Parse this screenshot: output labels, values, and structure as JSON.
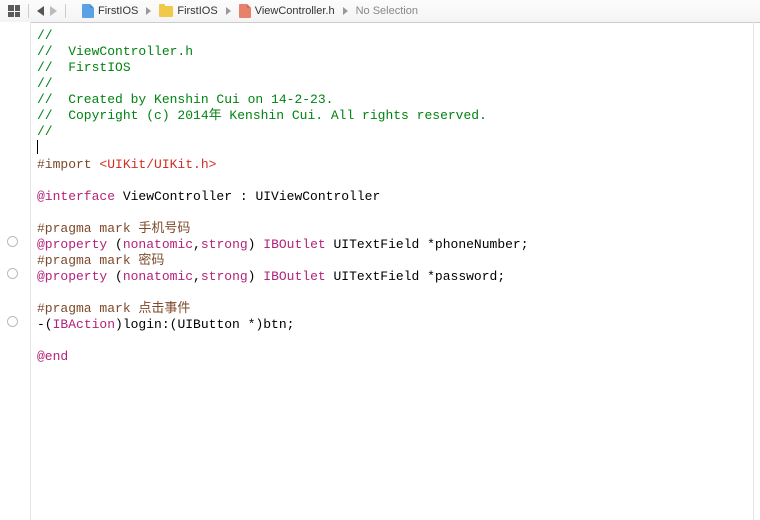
{
  "breadcrumb": {
    "items": [
      {
        "label": "FirstIOS"
      },
      {
        "label": "FirstIOS"
      },
      {
        "label": "ViewController.h"
      },
      {
        "label": "No Selection"
      }
    ]
  },
  "code": {
    "l0": "//",
    "l1": "//  ViewController.h",
    "l2": "//  FirstIOS",
    "l3": "//",
    "l4": "//  Created by Kenshin Cui on 14-2-23.",
    "l5": "//  Copyright (c) 2014年 Kenshin Cui. All rights reserved.",
    "l6": "//",
    "imp_a": "#import ",
    "imp_b": "<UIKit/UIKit.h>",
    "iface_a": "@interface",
    "iface_b": " ViewController : UIViewController",
    "pragma1_a": "#pragma mark ",
    "pragma1_b": "手机号码",
    "prop1_a": "@property",
    "prop1_b": " (",
    "prop1_c": "nonatomic",
    "prop1_d": ",",
    "prop1_e": "strong",
    "prop1_f": ") ",
    "prop1_g": "IBOutlet",
    "prop1_h": " UITextField *phoneNumber;",
    "pragma2_a": "#pragma mark ",
    "pragma2_b": "密码",
    "prop2_a": "@property",
    "prop2_b": " (",
    "prop2_c": "nonatomic",
    "prop2_d": ",",
    "prop2_e": "strong",
    "prop2_f": ") ",
    "prop2_g": "IBOutlet",
    "prop2_h": " UITextField *password;",
    "pragma3_a": "#pragma mark ",
    "pragma3_b": "点击事件",
    "act_a": "-(",
    "act_b": "IBAction",
    "act_c": ")login:(UIButton *)btn;",
    "end": "@end"
  }
}
